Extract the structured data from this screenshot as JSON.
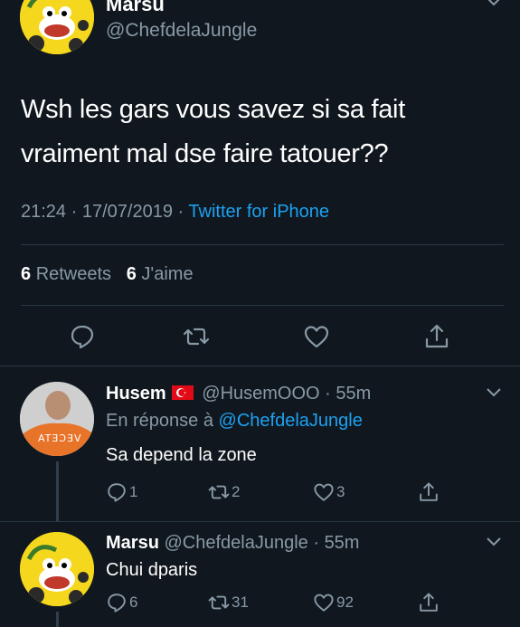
{
  "colors": {
    "background": "#10171e",
    "muted": "#8899a6",
    "link": "#1da1f2",
    "divider": "#2a3844"
  },
  "main_tweet": {
    "author_name": "Marsu",
    "author_handle": "@ChefdelaJungle",
    "text_line1": "Wsh les gars vous savez si sa fait",
    "text_line2": "vraiment mal dse faire tatouer??",
    "time": "21:24",
    "date": "17/07/2019",
    "dot": "·",
    "source": "Twitter for iPhone",
    "retweets_count": "6",
    "retweets_label": "Retweets",
    "likes_count": "6",
    "likes_label": "J'aime",
    "icons": [
      "reply-icon",
      "retweet-icon",
      "like-icon",
      "share-icon"
    ]
  },
  "replies": [
    {
      "author_name": "Husem",
      "flag": "turkey-flag-icon",
      "author_handle": "@HusemOOO",
      "time": "55m",
      "dot": "·",
      "reply_prefix": "En réponse à",
      "reply_to": "@ChefdelaJungle",
      "avatar_label": "ATƎƆƎV",
      "text": "Sa depend la zone",
      "reply_count": "1",
      "retweet_count": "2",
      "like_count": "3"
    },
    {
      "author_name": "Marsu",
      "author_handle": "@ChefdelaJungle",
      "time": "55m",
      "dot": "·",
      "text": "Chui dparis",
      "reply_count": "6",
      "retweet_count": "31",
      "like_count": "92"
    }
  ]
}
